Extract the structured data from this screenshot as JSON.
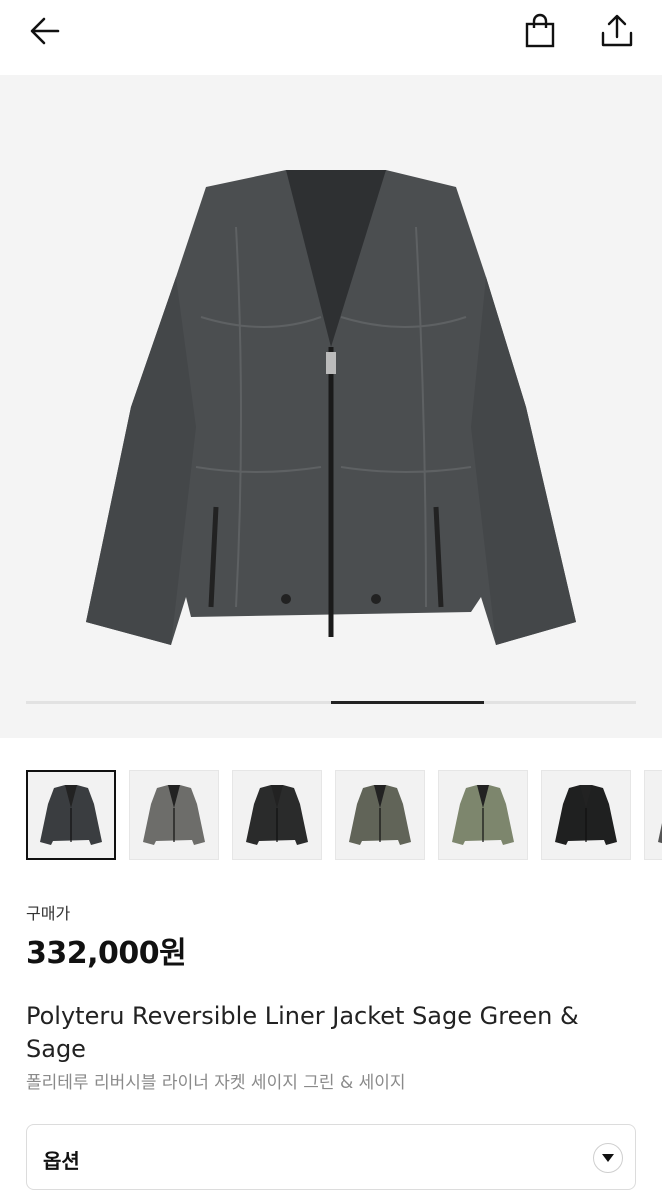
{
  "header": {
    "back_icon": "arrow-left-icon",
    "bag_icon": "shopping-bag-icon",
    "share_icon": "share-upload-icon"
  },
  "gallery": {
    "current_index": 3,
    "total": 4
  },
  "thumbnails": [
    {
      "name": "thumb-dark-charcoal",
      "color": "#3a3d40",
      "selected": true
    },
    {
      "name": "thumb-grey",
      "color": "#6d6d6a",
      "selected": false
    },
    {
      "name": "thumb-black",
      "color": "#2a2b2b",
      "selected": false
    },
    {
      "name": "thumb-olive-grey",
      "color": "#616458",
      "selected": false
    },
    {
      "name": "thumb-sage-green",
      "color": "#7d866d",
      "selected": false
    },
    {
      "name": "thumb-black-2",
      "color": "#1f2020",
      "selected": false
    },
    {
      "name": "thumb-partial",
      "color": "#555555",
      "selected": false
    }
  ],
  "product": {
    "price_label": "구매가",
    "price": "332,000원",
    "title_en": "Polyteru Reversible Liner Jacket Sage Green & Sage",
    "title_ko": "폴리테루 리버시블 라이너 자켓 세이지 그린 & 세이지"
  },
  "option": {
    "label": "옵션",
    "arrow_icon": "chevron-down-icon"
  },
  "colors": {
    "jacket_main": "#4b4e50",
    "hero_bg": "#f4f4f4",
    "accent": "#111111"
  }
}
